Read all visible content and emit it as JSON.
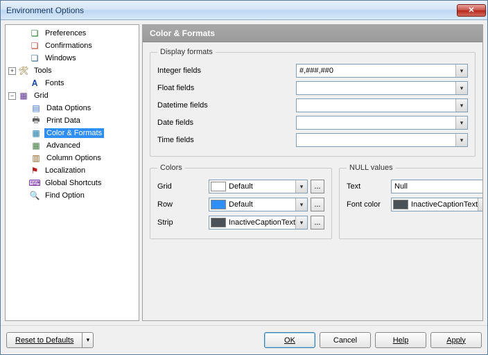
{
  "window": {
    "title": "Environment Options",
    "close_label": "✕"
  },
  "tree": {
    "preferences": "Preferences",
    "confirmations": "Confirmations",
    "windows": "Windows",
    "tools": "Tools",
    "fonts": "Fonts",
    "grid": "Grid",
    "grid_children": {
      "data_options": "Data Options",
      "print_data": "Print Data",
      "color_formats": "Color & Formats",
      "advanced": "Advanced",
      "column_options": "Column Options"
    },
    "localization": "Localization",
    "global_shortcuts": "Global Shortcuts",
    "find_option": "Find Option",
    "expand": "+",
    "collapse": "−"
  },
  "header": {
    "title": "Color & Formats"
  },
  "display_formats": {
    "legend": "Display formats",
    "integer_label": "Integer fields",
    "integer_value": "#,###,##0",
    "float_label": "Float fields",
    "float_value": "",
    "datetime_label": "Datetime fields",
    "datetime_value": "",
    "date_label": "Date fields",
    "date_value": "",
    "time_label": "Time fields",
    "time_value": ""
  },
  "colors": {
    "legend": "Colors",
    "grid_label": "Grid",
    "grid_value": "Default",
    "row_label": "Row",
    "row_value": "Default",
    "strip_label": "Strip",
    "strip_value": "InactiveCaptionText"
  },
  "null_values": {
    "legend": "NULL values",
    "text_label": "Text",
    "text_value": "Null",
    "fontcolor_label": "Font color",
    "fontcolor_value": "InactiveCaptionText"
  },
  "more_btn": "...",
  "chevron": "▾",
  "footer": {
    "reset": "Reset to Defaults",
    "ok": "OK",
    "cancel": "Cancel",
    "help": "Help",
    "apply": "Apply"
  }
}
